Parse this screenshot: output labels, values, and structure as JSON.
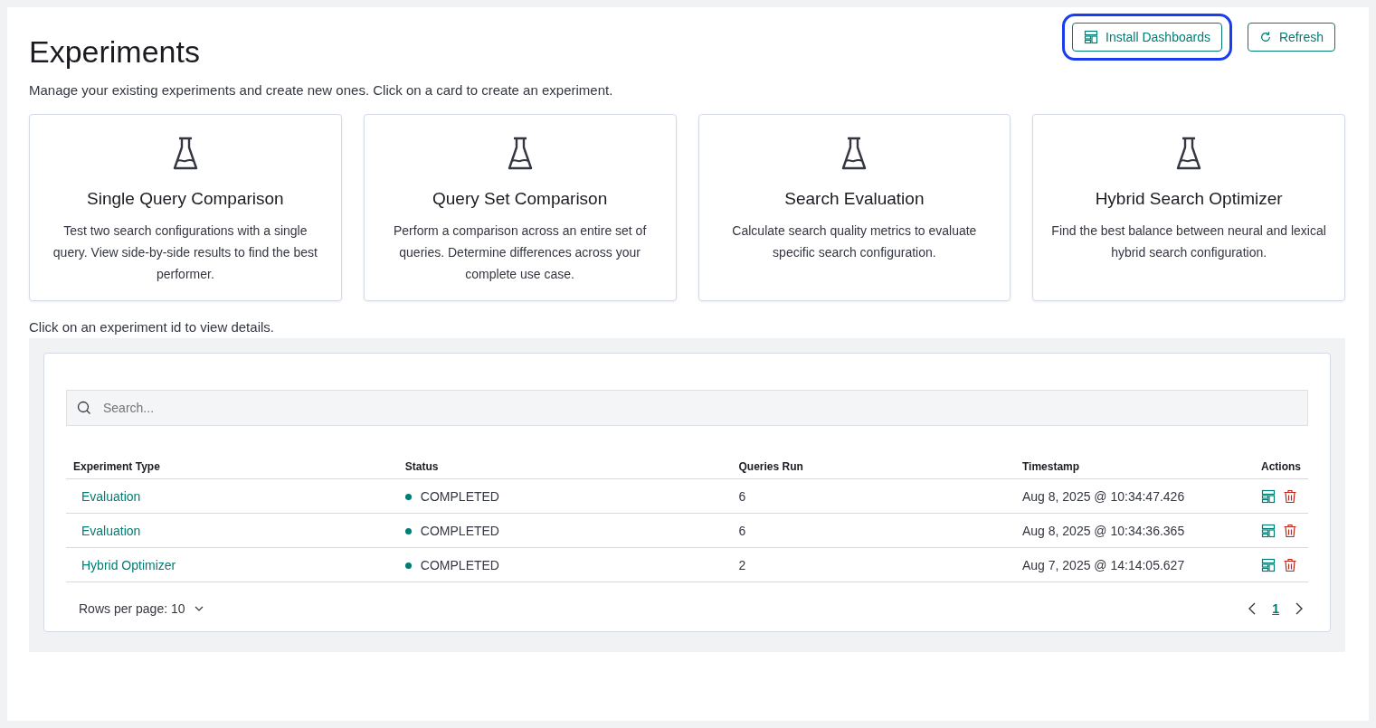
{
  "header": {
    "title": "Experiments",
    "buttons": [
      {
        "label": "Install Dashboards",
        "kind": "dashboards",
        "focused": true
      },
      {
        "label": "Refresh",
        "kind": "refresh",
        "focused": false
      }
    ]
  },
  "intro": "Manage your existing experiments and create new ones. Click on a card to create an experiment.",
  "cards": [
    {
      "title": "Single Query Comparison",
      "description": "Test two search configurations with a single query. View side-by-side results to find the best performer."
    },
    {
      "title": "Query Set Comparison",
      "description": "Perform a comparison across an entire set of queries. Determine differences across your complete use case."
    },
    {
      "title": "Search Evaluation",
      "description": "Calculate search quality metrics to evaluate specific search configuration."
    },
    {
      "title": "Hybrid Search Optimizer",
      "description": "Find the best balance between neural and lexical hybrid search configuration."
    }
  ],
  "table_hint": "Click on an experiment id to view details.",
  "search": {
    "placeholder": "Search..."
  },
  "table": {
    "columns": [
      "Experiment Type",
      "Status",
      "Queries Run",
      "Timestamp",
      "Actions"
    ],
    "rows": [
      {
        "type": "Evaluation",
        "status": "COMPLETED",
        "color": "#017d73",
        "queries": "6",
        "timestamp": "Aug 8, 2025 @ 10:34:47.426"
      },
      {
        "type": "Evaluation",
        "status": "COMPLETED",
        "color": "#017d73",
        "queries": "6",
        "timestamp": "Aug 8, 2025 @ 10:34:36.365"
      },
      {
        "type": "Hybrid Optimizer",
        "status": "COMPLETED",
        "color": "#017d73",
        "queries": "2",
        "timestamp": "Aug 7, 2025 @ 14:14:05.627"
      }
    ]
  },
  "pagination": {
    "rows_per_page": "Rows per page: 10",
    "pages": [
      {
        "label": "1",
        "selected": true
      }
    ]
  }
}
